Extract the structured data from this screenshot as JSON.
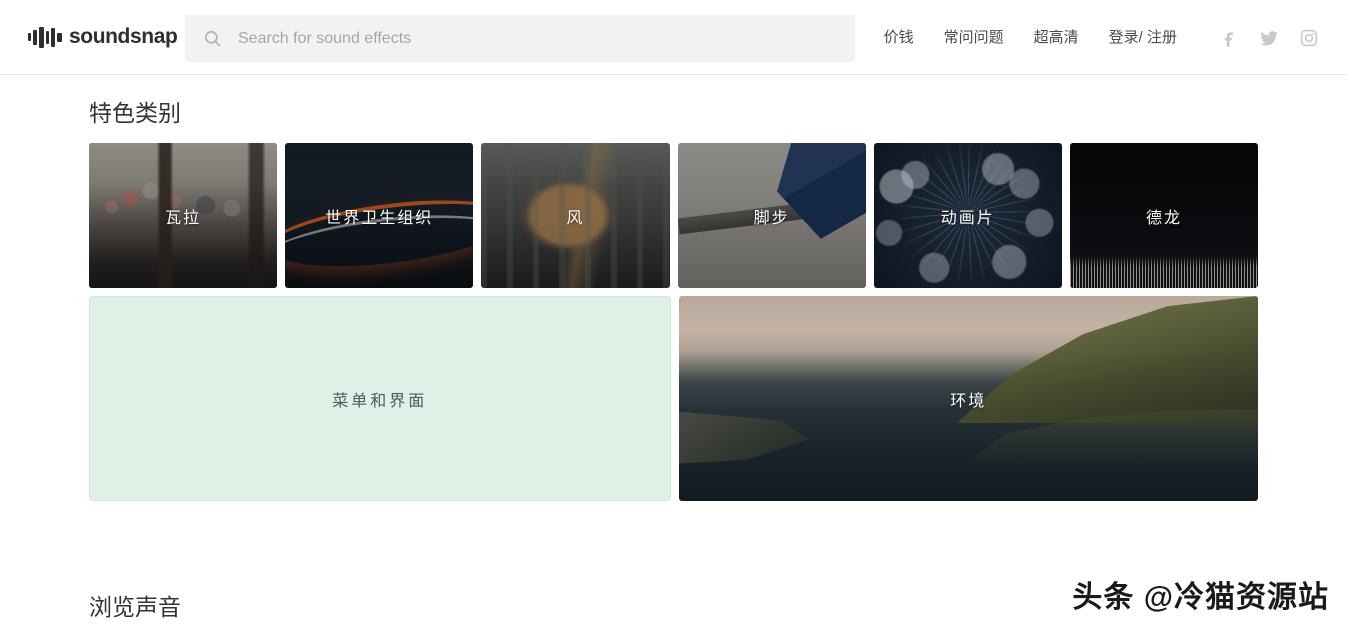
{
  "header": {
    "logo_text": "soundsnap",
    "logo_icon": "waveform-icon",
    "search": {
      "icon": "search-icon",
      "placeholder": "Search for sound effects",
      "value": ""
    },
    "nav_items": [
      {
        "label": "价钱"
      },
      {
        "label": "常问问题"
      },
      {
        "label": "超高清"
      },
      {
        "label": "登录/ 注册"
      }
    ],
    "socials": [
      {
        "name": "facebook-icon"
      },
      {
        "name": "twitter-icon"
      },
      {
        "name": "instagram-icon"
      }
    ]
  },
  "main": {
    "featured_title": "特色类别",
    "featured_cards_small": [
      {
        "label": "瓦拉",
        "art": "cafe-terrace-photo"
      },
      {
        "label": "世界卫生组织",
        "art": "night-light-trails-photo"
      },
      {
        "label": "风",
        "art": "windblown-hair-photo"
      },
      {
        "label": "脚步",
        "art": "shoe-on-steps-photo"
      },
      {
        "label": "动画片",
        "art": "cartoon-burst-graphic"
      },
      {
        "label": "德龙",
        "art": "dark-waveform-graphic"
      }
    ],
    "featured_cards_big": [
      {
        "label": "菜单和界面",
        "art": "mint-solid-color"
      },
      {
        "label": "环境",
        "art": "lake-landscape-photo"
      }
    ],
    "browse_title": "浏览声音"
  },
  "overlay": {
    "watermark": "头条 @冷猫资源站"
  },
  "colors": {
    "page_bg": "#ffffff",
    "search_bg": "#f2f2f2",
    "text_primary": "#333333",
    "text_nav": "#4a4a4a",
    "mint_card": "#dff0e7",
    "mint_card_text": "#4d5a5c",
    "social_icon": "#c8c8c8",
    "header_border": "#e4e4e4"
  }
}
